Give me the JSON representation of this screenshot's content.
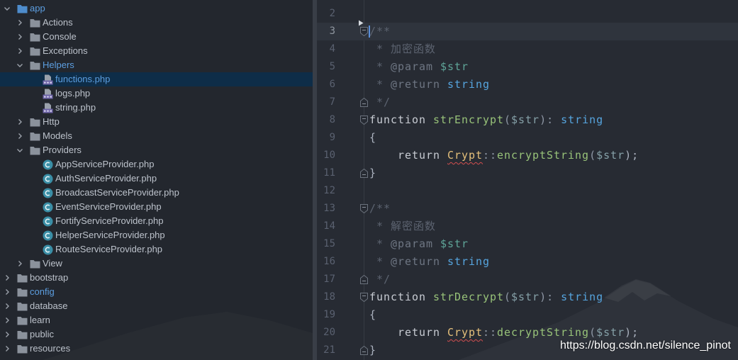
{
  "project_tree": {
    "items": [
      {
        "label": "app",
        "icon": "source-folder-icon",
        "expanded": true,
        "highlighted": true,
        "children": [
          {
            "label": "Actions",
            "icon": "folder-icon",
            "expanded": false
          },
          {
            "label": "Console",
            "icon": "folder-icon",
            "expanded": false
          },
          {
            "label": "Exceptions",
            "icon": "folder-icon",
            "expanded": false
          },
          {
            "label": "Helpers",
            "icon": "folder-icon",
            "expanded": true,
            "highlighted": true,
            "children": [
              {
                "label": "functions.php",
                "icon": "php-file-icon",
                "selected": true,
                "highlighted": true
              },
              {
                "label": "logs.php",
                "icon": "php-file-icon"
              },
              {
                "label": "string.php",
                "icon": "php-file-icon"
              }
            ]
          },
          {
            "label": "Http",
            "icon": "folder-icon",
            "expanded": false
          },
          {
            "label": "Models",
            "icon": "folder-icon",
            "expanded": false
          },
          {
            "label": "Providers",
            "icon": "folder-icon",
            "expanded": true,
            "children": [
              {
                "label": "AppServiceProvider.php",
                "icon": "php-class-icon"
              },
              {
                "label": "AuthServiceProvider.php",
                "icon": "php-class-icon"
              },
              {
                "label": "BroadcastServiceProvider.php",
                "icon": "php-class-icon"
              },
              {
                "label": "EventServiceProvider.php",
                "icon": "php-class-icon"
              },
              {
                "label": "FortifyServiceProvider.php",
                "icon": "php-class-icon"
              },
              {
                "label": "HelperServiceProvider.php",
                "icon": "php-class-icon"
              },
              {
                "label": "RouteServiceProvider.php",
                "icon": "php-class-icon"
              }
            ]
          },
          {
            "label": "View",
            "icon": "folder-icon",
            "expanded": false
          }
        ]
      },
      {
        "label": "bootstrap",
        "icon": "folder-icon",
        "expanded": false
      },
      {
        "label": "config",
        "icon": "folder-icon",
        "expanded": false,
        "highlighted": true
      },
      {
        "label": "database",
        "icon": "folder-icon",
        "expanded": false
      },
      {
        "label": "learn",
        "icon": "folder-icon",
        "expanded": false
      },
      {
        "label": "public",
        "icon": "folder-icon",
        "expanded": false
      },
      {
        "label": "resources",
        "icon": "folder-icon",
        "expanded": false
      }
    ]
  },
  "editor": {
    "lines": [
      {
        "number": 2,
        "tokens": []
      },
      {
        "number": 3,
        "current": true,
        "fold": "fold-start-icon",
        "gutter_icon": "gutter-arrow-icon",
        "tokens": [
          {
            "text": "/**",
            "color": "#5c6370"
          }
        ]
      },
      {
        "number": 4,
        "tokens": [
          {
            "text": " * 加密函数",
            "color": "#5c6370"
          }
        ]
      },
      {
        "number": 5,
        "tokens": [
          {
            "text": " * ",
            "color": "#5c6370"
          },
          {
            "text": "@param",
            "color": "#6e7683"
          },
          {
            "text": " $str",
            "color": "#5fa598"
          }
        ]
      },
      {
        "number": 6,
        "tokens": [
          {
            "text": " * ",
            "color": "#5c6370"
          },
          {
            "text": "@return",
            "color": "#6e7683"
          },
          {
            "text": " string",
            "color": "#56a5df"
          }
        ]
      },
      {
        "number": 7,
        "fold": "fold-end-icon",
        "tokens": [
          {
            "text": " */",
            "color": "#5c6370"
          }
        ]
      },
      {
        "number": 8,
        "fold": "fold-start-icon",
        "tokens": [
          {
            "text": "function ",
            "color": "#c8ccd3"
          },
          {
            "text": "strEncrypt",
            "color": "#98c379"
          },
          {
            "text": "(",
            "color": "#8f98a6"
          },
          {
            "text": "$str",
            "color": "#86a1a8"
          },
          {
            "text": "): ",
            "color": "#8f98a6"
          },
          {
            "text": "string",
            "color": "#56a5df"
          }
        ]
      },
      {
        "number": 9,
        "tokens": [
          {
            "text": "{",
            "color": "#abb2bf"
          }
        ]
      },
      {
        "number": 10,
        "tokens": [
          {
            "text": "    return ",
            "color": "#c8ccd3"
          },
          {
            "text": "Crypt",
            "color": "#e5c07b",
            "squiggle": true
          },
          {
            "text": "::",
            "color": "#8f98a6"
          },
          {
            "text": "encryptString",
            "color": "#98c379"
          },
          {
            "text": "(",
            "color": "#8f98a6"
          },
          {
            "text": "$str",
            "color": "#86a1a8"
          },
          {
            "text": ");",
            "color": "#abb2bf"
          }
        ]
      },
      {
        "number": 11,
        "fold": "fold-end-icon",
        "tokens": [
          {
            "text": "}",
            "color": "#abb2bf"
          }
        ]
      },
      {
        "number": 12,
        "tokens": []
      },
      {
        "number": 13,
        "fold": "fold-start-icon",
        "tokens": [
          {
            "text": "/**",
            "color": "#5c6370"
          }
        ]
      },
      {
        "number": 14,
        "tokens": [
          {
            "text": " * 解密函数",
            "color": "#5c6370"
          }
        ]
      },
      {
        "number": 15,
        "tokens": [
          {
            "text": " * ",
            "color": "#5c6370"
          },
          {
            "text": "@param",
            "color": "#6e7683"
          },
          {
            "text": " $str",
            "color": "#5fa598"
          }
        ]
      },
      {
        "number": 16,
        "tokens": [
          {
            "text": " * ",
            "color": "#5c6370"
          },
          {
            "text": "@return",
            "color": "#6e7683"
          },
          {
            "text": " string",
            "color": "#56a5df"
          }
        ]
      },
      {
        "number": 17,
        "fold": "fold-end-icon",
        "tokens": [
          {
            "text": " */",
            "color": "#5c6370"
          }
        ]
      },
      {
        "number": 18,
        "fold": "fold-start-icon",
        "tokens": [
          {
            "text": "function ",
            "color": "#c8ccd3"
          },
          {
            "text": "strDecrypt",
            "color": "#98c379"
          },
          {
            "text": "(",
            "color": "#8f98a6"
          },
          {
            "text": "$str",
            "color": "#86a1a8"
          },
          {
            "text": "): ",
            "color": "#8f98a6"
          },
          {
            "text": "string",
            "color": "#56a5df"
          }
        ]
      },
      {
        "number": 19,
        "tokens": [
          {
            "text": "{",
            "color": "#abb2bf"
          }
        ]
      },
      {
        "number": 20,
        "tokens": [
          {
            "text": "    return ",
            "color": "#c8ccd3"
          },
          {
            "text": "Crypt",
            "color": "#e5c07b",
            "squiggle": true
          },
          {
            "text": "::",
            "color": "#8f98a6"
          },
          {
            "text": "decryptString",
            "color": "#98c379"
          },
          {
            "text": "(",
            "color": "#8f98a6"
          },
          {
            "text": "$str",
            "color": "#86a1a8"
          },
          {
            "text": ");",
            "color": "#abb2bf"
          }
        ]
      },
      {
        "number": 21,
        "fold": "fold-end-icon",
        "tokens": [
          {
            "text": "}",
            "color": "#abb2bf"
          }
        ]
      }
    ]
  },
  "watermark": {
    "text": "https://blog.csdn.net/silence_pinot"
  },
  "colors": {
    "tree_label": "#bcc2cb",
    "tree_label_highlighted": "#5c9ee0",
    "tree_selection": "#0e2d48",
    "current_line": "#2f343d",
    "caret": "#5b8fd9",
    "squiggle": "#d24e4e",
    "watermark": "#ffffff"
  }
}
